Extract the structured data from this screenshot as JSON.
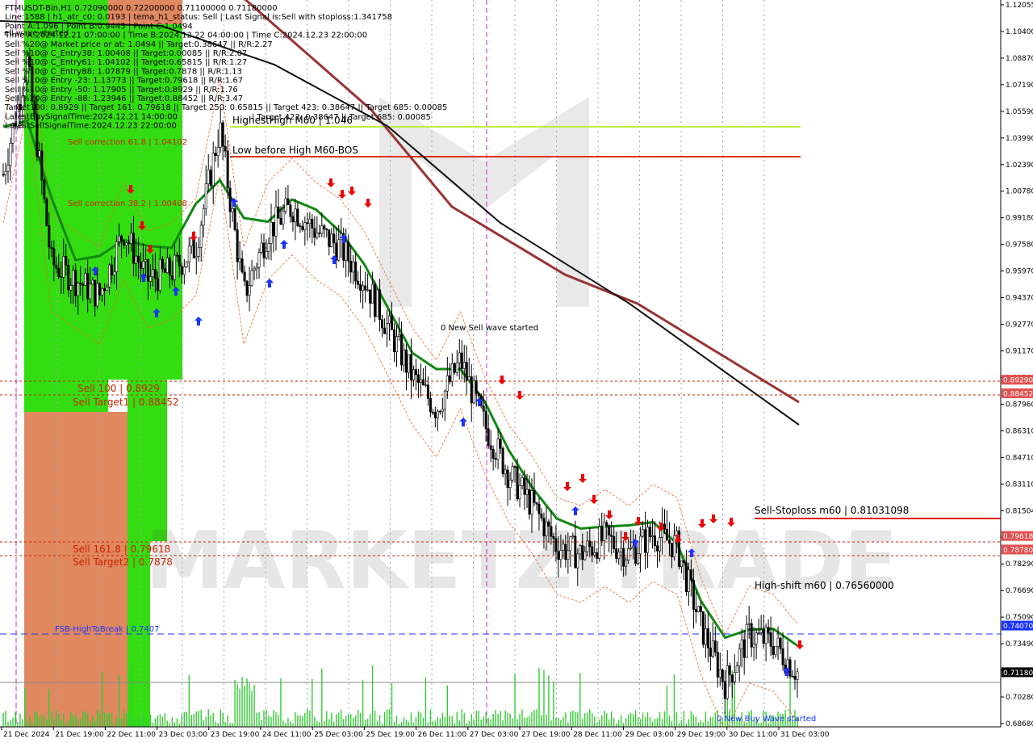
{
  "header": {
    "lines": [
      "FTMUSDT-Bin,H1  0.72090000 0.72200000 0.71100000 0.71180000",
      "Line:1588 | h1_atr_c0: 0.0193 | tema_h1_status: Sell | Last Signal is:Sell with stoploss:1.341758",
      "Point A:1.096 | Point B:0.9443 | Point C:1.0494",
      "Time A:2024.12.21 07:00:00 | Time B:2024.12.22 04:00:00 | Time C:2024.12.23 22:00:00",
      "Sell %20@ Market price or at: 1.0494 || Target:0.38647 || R/R:2.27",
      "Sell %10@ C_Entry38: 1.00408 || Target:0.00085 || R/R:2.07",
      "Sell %10@ C_Entry61: 1.04102 || Target:0.65815 || R/R:1.27",
      "Sell %10@ C_Entry88: 1.07879 || Target:0.7878 || R/R:1.13",
      "Sell %10@ Entry -23: 1.13773 || Target:0.79618 || R/R:1.67",
      "Sell %10@ Entry -50: 1.17905 || Target:0.8929 || R/R:1.76",
      "Sell %20@ Entry -88: 1.23946 || Target:0.88452 || R/R:3.47",
      "Target100: 0.8929 || Target 161: 0.79618 || Target 250: 0.65815 || Target 423: 0.38647 || Target 685: 0.00085",
      "LatestBuySignalTime:2024.12.21 14:00:00",
      "LatestSellSignalTime:2024.12.23 22:00:00"
    ],
    "overlay_text": "ell wave started"
  },
  "price_axis": {
    "ticks": [
      "1.12055",
      "1.10400",
      "1.08870",
      "1.07190",
      "1.05590",
      "1.03990",
      "1.02390",
      "1.00780",
      "0.99180",
      "0.97580",
      "0.95970",
      "0.94370",
      "0.92770",
      "0.91170",
      "0.89560",
      "0.87960",
      "0.86310",
      "0.84710",
      "0.83110",
      "0.81504",
      "0.79900",
      "0.78290",
      "0.76690",
      "0.75090",
      "0.73490",
      "0.71880",
      "0.70280",
      "0.68680"
    ],
    "markers": [
      {
        "text": "0.89290",
        "color": "#e05050"
      },
      {
        "text": "0.88452",
        "color": "#e05050"
      },
      {
        "text": "0.79618",
        "color": "#e05050"
      },
      {
        "text": "0.78780",
        "color": "#e05050"
      },
      {
        "text": "0.74070",
        "color": "#1a33ff"
      },
      {
        "text": "0.71180",
        "color": "#000000"
      }
    ]
  },
  "time_axis": {
    "ticks": [
      "21 Dec 2024",
      "21 Dec 19:00",
      "22 Dec 11:00",
      "23 Dec 03:00",
      "23 Dec 19:00",
      "24 Dec 11:00",
      "25 Dec 03:00",
      "25 Dec 19:00",
      "26 Dec 11:00",
      "27 Dec 03:00",
      "27 Dec 19:00",
      "28 Dec 11:00",
      "29 Dec 03:00",
      "29 Dec 19:00",
      "30 Dec 11:00",
      "31 Dec 03:00"
    ]
  },
  "labels": {
    "sell_100": "Sell 100 | 0.8929",
    "sell_target1": "Sell Target1 | 0.88452",
    "sell_161": "Sell 161.8 | 0.79618",
    "sell_target2": "Sell Target2 | 0.7878",
    "fsb": "FSB-HighToBreak | 0.7407",
    "sell_correction_61": "Sell correction 61.8 | 1.04102",
    "sell_correction_38": "Sell correction 38.2 | 1.00408",
    "highest_high": "HighestHigh   M60 | 1.046",
    "low_before_high": "Low before High   M60-BOS",
    "new_sell_wave": "0 New Sell wave started",
    "sell_stoploss": "Sell-Stoploss m60 | 0.81031098",
    "high_shift": "High-shift m60 | 0.76560000",
    "new_buy_wave": "0 New Buy Wave started",
    "target_line_text": "| Target 423: 0.38647 || Target 685: 0.00085",
    "watermark": "MARKETZITRADE"
  },
  "colors": {
    "green_zone": "#33dd11",
    "orange_zone": "#e08860",
    "sell_red": "#cc2200",
    "stoploss_red": "#dd0000",
    "fsb_blue": "#1a33ff",
    "lime_line": "#bbee44",
    "ma_green": "#118811",
    "ma_brown": "#993333",
    "ma_black": "#111111",
    "candle": "#000000",
    "volume": "#33cc33",
    "arrow_up": "#1a33ff",
    "arrow_down": "#ee0000"
  },
  "chart_data": {
    "type": "candlestick",
    "symbol": "FTMUSDT-Bin",
    "timeframe": "H1",
    "ohlc_last": {
      "open": 0.7209,
      "high": 0.722,
      "low": 0.711,
      "close": 0.7118
    },
    "y_range": [
      0.68,
      1.125
    ],
    "close_path": [
      [
        "21 Dec 2024",
        1.02
      ],
      [
        "21 Dec 07:00",
        1.09
      ],
      [
        "21 Dec 14:00",
        0.965
      ],
      [
        "21 Dec 19:00",
        0.955
      ],
      [
        "22 Dec 04:00",
        0.945
      ],
      [
        "22 Dec 11:00",
        0.985
      ],
      [
        "22 Dec 20:00",
        0.955
      ],
      [
        "23 Dec 03:00",
        0.96
      ],
      [
        "23 Dec 12:00",
        0.975
      ],
      [
        "23 Dec 22:00",
        1.049
      ],
      [
        "24 Dec 06:00",
        0.945
      ],
      [
        "24 Dec 11:00",
        0.985
      ],
      [
        "24 Dec 20:00",
        1.0
      ],
      [
        "25 Dec 03:00",
        0.985
      ],
      [
        "25 Dec 12:00",
        0.975
      ],
      [
        "25 Dec 19:00",
        0.955
      ],
      [
        "26 Dec 03:00",
        0.925
      ],
      [
        "26 Dec 11:00",
        0.895
      ],
      [
        "26 Dec 20:00",
        0.875
      ],
      [
        "27 Dec 03:00",
        0.905
      ],
      [
        "27 Dec 10:00",
        0.865
      ],
      [
        "27 Dec 19:00",
        0.835
      ],
      [
        "28 Dec 04:00",
        0.815
      ],
      [
        "28 Dec 11:00",
        0.79
      ],
      [
        "28 Dec 20:00",
        0.785
      ],
      [
        "29 Dec 03:00",
        0.795
      ],
      [
        "29 Dec 12:00",
        0.785
      ],
      [
        "29 Dec 19:00",
        0.798
      ],
      [
        "30 Dec 03:00",
        0.79
      ],
      [
        "30 Dec 11:00",
        0.74
      ],
      [
        "30 Dec 16:00",
        0.705
      ],
      [
        "30 Dec 22:00",
        0.735
      ],
      [
        "31 Dec 03:00",
        0.73
      ],
      [
        "31 Dec 08:00",
        0.7118
      ]
    ],
    "horizontal_levels": [
      {
        "name": "Sell 100",
        "value": 0.8929
      },
      {
        "name": "Sell Target1",
        "value": 0.88452
      },
      {
        "name": "Sell 161.8",
        "value": 0.79618
      },
      {
        "name": "Sell Target2",
        "value": 0.7878
      },
      {
        "name": "FSB-HighToBreak",
        "value": 0.7407
      },
      {
        "name": "Sell-Stoploss m60",
        "value": 0.81031098
      },
      {
        "name": "HighestHigh M60",
        "value": 1.046
      },
      {
        "name": "Low before High M60-BOS",
        "value": 1.027
      },
      {
        "name": "last price",
        "value": 0.7118
      }
    ]
  }
}
